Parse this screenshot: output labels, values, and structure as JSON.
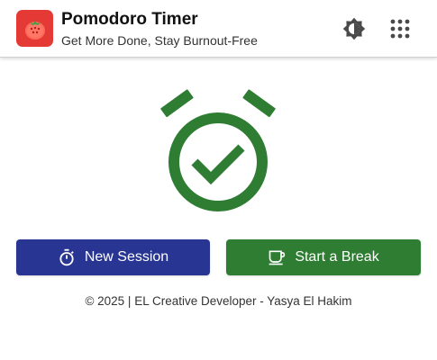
{
  "header": {
    "title": "Pomodoro Timer",
    "subtitle": "Get More Done, Stay Burnout-Free",
    "logo_icon": "tomato-icon",
    "theme_icon": "brightness-icon",
    "apps_icon": "apps-grid-icon"
  },
  "hero": {
    "icon": "alarm-check-icon"
  },
  "actions": {
    "new_session_label": "New Session",
    "new_session_icon": "timer-icon",
    "start_break_label": "Start a Break",
    "start_break_icon": "coffee-cup-icon"
  },
  "footer": {
    "text": "© 2025 | EL Creative Developer - Yasya El Hakim"
  },
  "colors": {
    "brand_red": "#e53935",
    "primary_blue": "#283593",
    "success_green": "#2e7d32"
  }
}
